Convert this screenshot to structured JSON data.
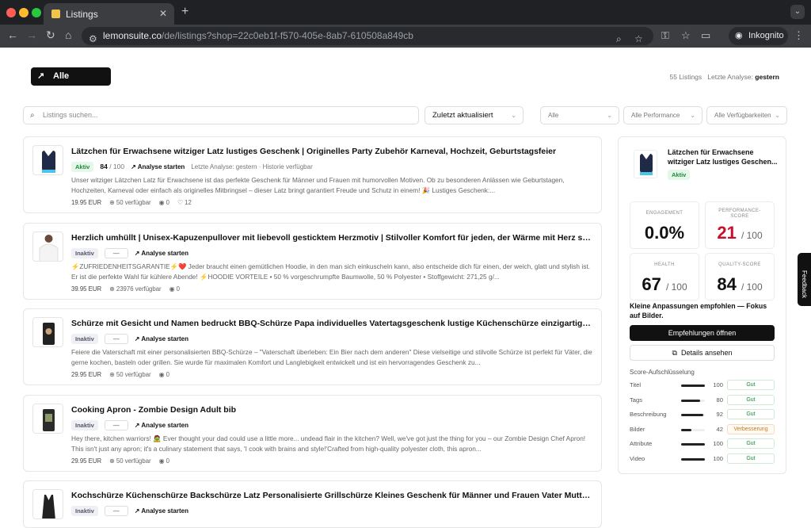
{
  "browser": {
    "tab_title": "Listings",
    "url_host": "lemonsuite.co",
    "url_path": "/de/listings?shop=22c0eb1f-f570-405e-8ab7-610508a849cb",
    "incognito_label": "Inkognito"
  },
  "header": {
    "analyze_all_label": "Alle analysieren",
    "listing_count": "55 Listings",
    "last_analysis_label": "Letzte Analyse:",
    "last_analysis_value": "gestern"
  },
  "filters": {
    "search_placeholder": "Listings suchen...",
    "sort_value": "Zuletzt aktualisiert",
    "status_value": "Alle",
    "performance_value": "Alle Performance",
    "availability_value": "Alle Verfügbarkeiten"
  },
  "listings": [
    {
      "title": "Lätzchen für Erwachsene witziger Latz lustiges Geschenk | Originelles Party Zubehör Karneval, Hochzeit, Geburtstagsfeier",
      "status": "Aktiv",
      "score": "84",
      "score_max": "/ 100",
      "action": "Analyse starten",
      "meta": "Letzte Analyse: gestern · Historie verfügbar",
      "description": "Unser witziger Lätzchen Latz für Erwachsene ist das perfekte Geschenk für Männer und Frauen mit humorvollen Motiven. Ob zu besonderen Anlässen wie Geburtstagen, Hochzeiten, Karneval oder einfach als originelles Mitbringsel – dieser Latz bringt garantiert Freude und Schutz in einem! 🎉 Lustiges Geschenk:...",
      "price": "19.95 EUR",
      "stock": "50 verfügbar",
      "views": "0",
      "likes": "12"
    },
    {
      "title": "Herzlich umhüllt | Unisex-Kapuzenpullover mit liebevoll gesticktem Herzmotiv | Stilvoller Komfort für jeden, der Wärme mit Herz sucht!",
      "status": "Inaktiv",
      "score": "—",
      "action": "Analyse starten",
      "description": "⚡ZUFRIEDENHEITSGARANTIE⚡❤️ Jeder braucht einen gemütlichen Hoodie, in den man sich einkuscheln kann, also entscheide dich für einen, der weich, glatt und stylish ist. Er ist die perfekte Wahl für kühlere Abende! ⚡HOODIE VORTEILE • 50 % vorgeschrumpfte Baumwolle, 50 % Polyester • Stoffgewicht: 271,25 g/...",
      "price": "39.95 EUR",
      "stock": "23976 verfügbar",
      "views": "0"
    },
    {
      "title": "Schürze mit Gesicht und Namen bedruckt BBQ-Schürze Papa individuelles Vatertagsgeschenk lustige Küchenschürze einzigartige Geschenk",
      "status": "Inaktiv",
      "score": "—",
      "action": "Analyse starten",
      "description": "Feiere die Vaterschaft mit einer personalisierten BBQ-Schürze – \"Vaterschaft überleben: Ein Bier nach dem anderen\" Diese vielseitige und stilvolle Schürze ist perfekt für Väter, die gerne kochen, basteln oder grillen. Sie wurde für maximalen Komfort und Langlebigkeit entwickelt und ist ein hervorragendes Geschenk zu...",
      "price": "29.95 EUR",
      "stock": "50 verfügbar",
      "views": "0"
    },
    {
      "title": "Cooking Apron - Zombie Design Adult bib",
      "status": "Inaktiv",
      "score": "—",
      "action": "Analyse starten",
      "description": "Hey there, kitchen warriors! 🧟 Ever thought your dad could use a little more... undead flair in the kitchen? Well, we've got just the thing for you – our Zombie Design Chef Apron! This isn't just any apron; it's a culinary statement that says, 'I cook with brains and style!'Crafted from high-quality polyester cloth, this apron...",
      "price": "29.95 EUR",
      "stock": "50 verfügbar",
      "views": "0"
    },
    {
      "title": "Kochschürze Küchenschürze Backschürze Latz Personalisierte Grillschürze Kleines Geschenk für Männer und Frauen Vater Mutter Geburtstag",
      "status": "Inaktiv",
      "score": "—",
      "action": "Analyse starten"
    }
  ],
  "detail": {
    "title": "Lätzchen für Erwachsene witziger Latz lustiges Geschen...",
    "status": "Aktiv",
    "metrics": [
      {
        "label": "ENGAGEMENT",
        "value": "0.0%",
        "suffix": ""
      },
      {
        "label": "PERFORMANCE-SCORE",
        "value": "21",
        "suffix": "/ 100",
        "color": "#c8102e"
      },
      {
        "label": "HEALTH",
        "value": "67",
        "suffix": "/ 100"
      },
      {
        "label": "QUALITY-SCORE",
        "value": "84",
        "suffix": "/ 100"
      }
    ],
    "recommendation": "Kleine Anpassungen empfohlen — Fokus auf Bilder.",
    "open_recommendations_label": "Empfehlungen öffnen",
    "details_label": "Details ansehen",
    "breakdown_title": "Score-Aufschlüsselung",
    "breakdown": [
      {
        "label": "Titel",
        "value": 100,
        "tag": "Gut"
      },
      {
        "label": "Tags",
        "value": 80,
        "tag": "Gut"
      },
      {
        "label": "Beschreibung",
        "value": 92,
        "tag": "Gut"
      },
      {
        "label": "Bilder",
        "value": 42,
        "tag": "Verbesserung"
      },
      {
        "label": "Attribute",
        "value": 100,
        "tag": "Gut"
      },
      {
        "label": "Video",
        "value": 100,
        "tag": "Gut"
      }
    ]
  },
  "feedback_label": "Feedback"
}
